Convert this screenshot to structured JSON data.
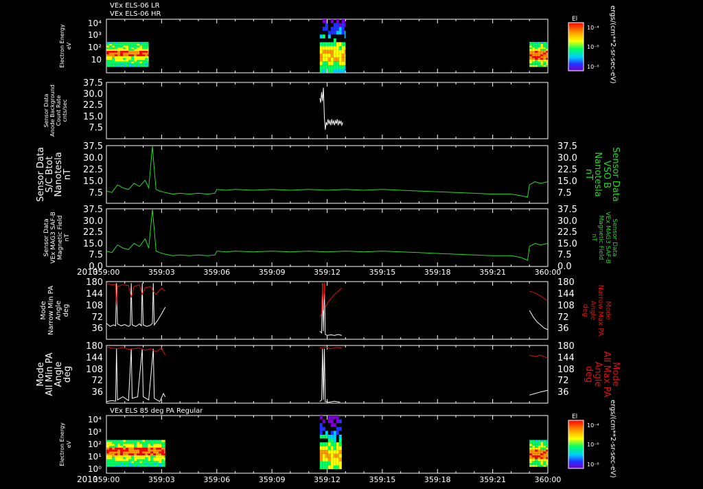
{
  "header": {
    "line1": "VEx ELS-06 LR",
    "line2": "VEx ELS-06 HR",
    "bottom_title": "VEx ELS 85 deg PA Regular"
  },
  "colors": {
    "white": "#ffffff",
    "green": "#22dd22",
    "red": "#dd1111",
    "background": "#000000"
  },
  "x_axis": {
    "year_label": "2010",
    "tick_labels": [
      "359:00",
      "359:03",
      "359:06",
      "359:09",
      "359:12",
      "359:15",
      "359:18",
      "359:21",
      "360:00"
    ],
    "range_hours": [
      0,
      24
    ]
  },
  "colorbars": [
    {
      "title": "El",
      "tick_labels": [
        "10⁻⁴",
        "10⁻⁶",
        "10⁻⁸"
      ],
      "unit_label": "ergs/(cm**2-sr-sec-eV)"
    },
    {
      "title": "El",
      "tick_labels": [
        "10⁻⁴",
        "10⁻⁶",
        "10⁻⁸"
      ],
      "unit_label": "ergs/(cm**2-sr-sec-eV)"
    }
  ],
  "chart_data": [
    {
      "type": "heatmap",
      "panel_id": "p1",
      "title": "VEx ELS-06 LR / VEx ELS-06 HR",
      "ylabel": [
        "Electron Energy",
        "eV"
      ],
      "yscale": "log",
      "ylim": [
        1,
        20000
      ],
      "tick_labels": [
        "10⁴",
        "10³",
        "10²",
        "10"
      ],
      "grid": false,
      "data_blocks": [
        {
          "x_start": 0.0,
          "x_end": 2.3,
          "energy_range": [
            3,
            300
          ],
          "core_energy": [
            20,
            60
          ],
          "peak_level": "high"
        },
        {
          "x_start": 11.6,
          "x_end": 13.0,
          "energy_range": [
            1,
            20000
          ],
          "core_energy": [
            10,
            80
          ],
          "peak_level": "medium"
        },
        {
          "x_start": 23.0,
          "x_end": 24.0,
          "energy_range": [
            3,
            300
          ],
          "core_energy": [
            10,
            50
          ],
          "peak_level": "high"
        }
      ]
    },
    {
      "type": "line",
      "panel_id": "p2",
      "ylabel": [
        "Sensor Data",
        "Anode Background",
        "Count Rate",
        "cnts/sec"
      ],
      "ylim": [
        0,
        37.5
      ],
      "tick_labels": [
        "37.5",
        "30.0",
        "22.5",
        "15.0",
        "7.5"
      ],
      "series": [
        {
          "color": "white",
          "x": [
            11.6,
            11.65,
            11.7,
            11.75,
            11.8,
            11.85,
            11.9,
            11.95,
            12.0,
            12.05,
            12.1,
            12.15,
            12.2,
            12.25,
            12.3,
            12.35,
            12.4,
            12.45,
            12.5,
            12.55,
            12.6,
            12.65,
            12.7,
            12.75,
            12.8,
            12.85
          ],
          "y": [
            27,
            24,
            31,
            25,
            34,
            14,
            6,
            11,
            9,
            13,
            10,
            12,
            9,
            13,
            10,
            12,
            9,
            12,
            10,
            13,
            9,
            12,
            10,
            12,
            9,
            11
          ]
        }
      ]
    },
    {
      "type": "line",
      "panel_id": "p3",
      "ylabel": [
        "Sensor Data",
        "S/C Btot",
        "Nanotesla",
        "nT"
      ],
      "ylabel_right": [
        "Sensor Data",
        "VSO B",
        "Nanotesla",
        "nT"
      ],
      "ylim": [
        0,
        37.5
      ],
      "tick_labels": [
        "37.5",
        "30.0",
        "22.5",
        "15.0",
        "7.5"
      ],
      "series": [
        {
          "color": "green",
          "x": [
            0.0,
            0.3,
            0.6,
            0.9,
            1.2,
            1.5,
            1.8,
            2.1,
            2.3,
            2.5,
            2.6,
            2.7,
            2.9,
            3.2,
            3.6,
            4.0,
            4.5,
            5.0,
            5.5,
            5.9,
            6.0,
            6.5,
            7.0,
            8.0,
            9.0,
            10.0,
            11.0,
            12.0,
            13.0,
            14.0,
            15.0,
            16.0,
            17.0,
            18.0,
            19.0,
            20.0,
            21.0,
            22.0,
            22.5,
            22.9,
            23.0,
            23.3,
            23.6,
            24.0
          ],
          "y": [
            8.0,
            7.0,
            12.0,
            10.0,
            9.0,
            13.0,
            11.0,
            15.0,
            10.0,
            37.0,
            22.0,
            9.0,
            8.0,
            7.0,
            6.0,
            6.5,
            6.0,
            6.5,
            6.0,
            6.5,
            9.0,
            8.5,
            9.0,
            8.5,
            9.0,
            8.5,
            9.0,
            8.5,
            9.0,
            8.5,
            9.0,
            8.5,
            8.0,
            7.5,
            7.0,
            6.5,
            6.0,
            6.0,
            5.0,
            4.0,
            12.0,
            14.0,
            13.0,
            14.0
          ]
        }
      ]
    },
    {
      "type": "line",
      "panel_id": "p4",
      "ylabel": [
        "Sensor Data",
        "VEx MAG3 SAF-B",
        "Magnetic Field",
        "nT"
      ],
      "ylabel_right": [
        "Sensor Data",
        "VEx MAG3 SAF-B",
        "Magnetic Field",
        "nT"
      ],
      "ylim": [
        0,
        37.5
      ],
      "tick_labels": [
        "37.5",
        "30.0",
        "22.5",
        "15.0",
        "7.5",
        "0.0"
      ],
      "series": [
        {
          "color": "green",
          "x": [
            0.0,
            0.3,
            0.6,
            0.9,
            1.2,
            1.5,
            1.8,
            2.1,
            2.3,
            2.5,
            2.6,
            2.7,
            2.9,
            3.2,
            3.6,
            4.0,
            4.5,
            5.0,
            5.5,
            5.9,
            6.0,
            6.5,
            7.0,
            8.0,
            9.0,
            10.0,
            11.0,
            12.0,
            13.0,
            14.0,
            15.0,
            16.0,
            17.0,
            18.0,
            19.0,
            20.0,
            21.0,
            22.0,
            22.5,
            22.9,
            23.0,
            23.3,
            23.6,
            24.0
          ],
          "y": [
            10.0,
            9.0,
            14.0,
            12.0,
            11.0,
            15.0,
            13.0,
            18.0,
            12.0,
            37.0,
            24.0,
            10.0,
            9.0,
            8.0,
            7.0,
            7.5,
            7.0,
            7.5,
            7.0,
            7.5,
            10.0,
            9.5,
            10.0,
            9.5,
            10.0,
            9.5,
            10.0,
            9.5,
            10.0,
            9.5,
            10.0,
            9.5,
            9.0,
            8.5,
            8.0,
            7.5,
            7.0,
            7.0,
            6.0,
            4.0,
            13.0,
            15.0,
            14.0,
            15.0
          ]
        }
      ]
    },
    {
      "type": "line",
      "panel_id": "p5",
      "ylabel": [
        "Mode",
        "Narrow Min PA",
        "Angle",
        "deg"
      ],
      "ylabel_right": [
        "Mode",
        "Narrow Max PA",
        "Angle",
        "deg"
      ],
      "ylim": [
        0,
        180
      ],
      "tick_labels": [
        "180",
        "144",
        "108",
        "72",
        "36"
      ],
      "series": [
        {
          "color": "white",
          "x": [
            0.0,
            0.2,
            0.4,
            0.5,
            0.55,
            0.6,
            0.8,
            1.0,
            1.2,
            1.3,
            1.35,
            1.4,
            1.6,
            1.8,
            1.9,
            1.95,
            2.0,
            2.2,
            2.4,
            2.5,
            2.55,
            2.6,
            2.8,
            3.0,
            3.2
          ],
          "y": [
            50,
            40,
            45,
            42,
            175,
            48,
            42,
            46,
            40,
            44,
            175,
            45,
            40,
            48,
            42,
            175,
            45,
            40,
            44,
            50,
            175,
            45,
            60,
            80,
            100
          ]
        },
        {
          "color": "white",
          "x": [
            11.6,
            11.7,
            11.75,
            11.8,
            11.85,
            11.9,
            12.0,
            12.2,
            12.4,
            12.6,
            12.8
          ],
          "y": [
            25,
            20,
            175,
            25,
            175,
            15,
            12,
            14,
            12,
            15,
            12
          ]
        },
        {
          "color": "white",
          "x": [
            23.0,
            23.2,
            23.4,
            23.6,
            23.8,
            24.0
          ],
          "y": [
            90,
            70,
            55,
            45,
            35,
            30
          ]
        },
        {
          "color": "red",
          "x": [
            0.0,
            0.3,
            0.5,
            0.55,
            0.6,
            0.9,
            1.2,
            1.35,
            1.5,
            1.8,
            1.95,
            2.1,
            2.4,
            2.55,
            2.7,
            3.0,
            3.2
          ],
          "y": [
            175,
            170,
            172,
            100,
            165,
            170,
            168,
            130,
            165,
            170,
            140,
            160,
            165,
            150,
            140,
            160,
            150
          ]
        },
        {
          "color": "red",
          "x": [
            11.6,
            11.7,
            11.75,
            11.8,
            11.85,
            11.9,
            12.1,
            12.4,
            12.6,
            12.8
          ],
          "y": [
            70,
            80,
            175,
            90,
            175,
            100,
            120,
            140,
            150,
            160
          ]
        },
        {
          "color": "red",
          "x": [
            23.0,
            23.3,
            23.6,
            24.0
          ],
          "y": [
            150,
            145,
            135,
            120
          ]
        }
      ]
    },
    {
      "type": "line",
      "panel_id": "p6",
      "ylabel": [
        "Mode",
        "All Min PA",
        "Angle",
        "deg"
      ],
      "ylabel_right": [
        "Mode",
        "All Max PA",
        "Angle",
        "deg"
      ],
      "ylim": [
        0,
        180
      ],
      "tick_labels": [
        "180",
        "144",
        "108",
        "72",
        "36"
      ],
      "series": [
        {
          "color": "white",
          "x": [
            0.0,
            0.3,
            0.5,
            0.55,
            0.6,
            0.9,
            1.2,
            1.35,
            1.4,
            1.7,
            1.95,
            2.0,
            2.3,
            2.55,
            2.6,
            2.9,
            3.1,
            3.2
          ],
          "y": [
            5,
            8,
            6,
            170,
            10,
            20,
            8,
            170,
            15,
            20,
            170,
            20,
            10,
            170,
            15,
            5,
            30,
            20
          ]
        },
        {
          "color": "white",
          "x": [
            11.6,
            11.7,
            11.75,
            11.8,
            11.85,
            11.9,
            12.1,
            12.4,
            12.7
          ],
          "y": [
            5,
            10,
            170,
            10,
            170,
            5,
            3,
            6,
            3
          ]
        },
        {
          "color": "white",
          "x": [
            23.0,
            23.3,
            23.6,
            24.0
          ],
          "y": [
            25,
            30,
            35,
            40
          ]
        },
        {
          "color": "red",
          "x": [
            0.0,
            0.3,
            0.6,
            0.9,
            1.2,
            1.5,
            1.8,
            2.1,
            2.4,
            2.7,
            3.0,
            3.2
          ],
          "y": [
            175,
            172,
            170,
            174,
            168,
            170,
            172,
            165,
            170,
            160,
            172,
            150
          ]
        },
        {
          "color": "red",
          "x": [
            11.6,
            11.9,
            12.2,
            12.5,
            12.8
          ],
          "y": [
            172,
            175,
            170,
            174,
            172
          ]
        },
        {
          "color": "red",
          "x": [
            23.0,
            23.3,
            23.6,
            24.0
          ],
          "y": [
            150,
            145,
            150,
            140
          ]
        }
      ]
    },
    {
      "type": "heatmap",
      "panel_id": "p7",
      "title": "VEx ELS 85 deg PA Regular",
      "ylabel": [
        "Electron Energy",
        "eV"
      ],
      "yscale": "log",
      "ylim": [
        1,
        20000
      ],
      "tick_labels": [
        "10⁴",
        "10³",
        "10²",
        "10¹",
        "10⁰"
      ],
      "grid": false,
      "data_blocks": [
        {
          "x_start": 0.0,
          "x_end": 3.2,
          "energy_range": [
            3,
            300
          ],
          "core_energy": [
            20,
            80
          ],
          "peak_level": "high"
        },
        {
          "x_start": 11.6,
          "x_end": 12.8,
          "energy_range": [
            2,
            20000
          ],
          "core_energy": [
            10,
            60
          ],
          "peak_level": "medium"
        },
        {
          "x_start": 23.0,
          "x_end": 24.0,
          "energy_range": [
            3,
            300
          ],
          "core_energy": [
            10,
            50
          ],
          "peak_level": "high"
        }
      ]
    }
  ]
}
